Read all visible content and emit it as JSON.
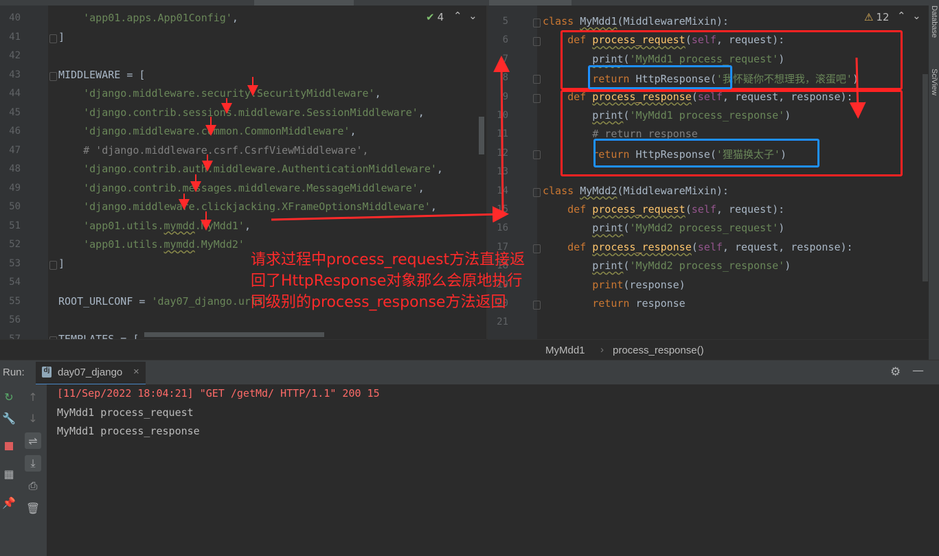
{
  "left_editor": {
    "lines": [
      {
        "n": "40",
        "html": "    <span class='str'>'app01.apps.App01Config'</span>,"
      },
      {
        "n": "41",
        "html": "]"
      },
      {
        "n": "42",
        "html": ""
      },
      {
        "n": "43",
        "html": "MIDDLEWARE = ["
      },
      {
        "n": "44",
        "html": "    <span class='str'>'django.middleware.security.SecurityMiddleware'</span>,"
      },
      {
        "n": "45",
        "html": "    <span class='str'>'django.contrib.sessions.middleware.SessionMiddleware'</span>,"
      },
      {
        "n": "46",
        "html": "    <span class='str'>'django.middleware.common.CommonMiddleware'</span>,"
      },
      {
        "n": "47",
        "html": "    <span class='cmt'># 'django.middleware.csrf.CsrfViewMiddleware',</span>"
      },
      {
        "n": "48",
        "html": "    <span class='str'>'django.contrib.auth.middleware.AuthenticationMiddleware'</span>,"
      },
      {
        "n": "49",
        "html": "    <span class='str'>'django.contrib.messages.middleware.MessageMiddleware'</span>,"
      },
      {
        "n": "50",
        "html": "    <span class='str'>'django.middleware.clickjacking.XFrameOptionsMiddleware'</span>,"
      },
      {
        "n": "51",
        "html": "    <span class='str'>'app01.utils.<span class=\"sq\">mymdd</span>.MyMdd1'</span>,"
      },
      {
        "n": "52",
        "html": "    <span class='str'>'app01.utils.<span class=\"sq\">mymdd</span>.MyMdd2'</span>"
      },
      {
        "n": "53",
        "html": "]"
      },
      {
        "n": "54",
        "html": ""
      },
      {
        "n": "55",
        "html": "ROOT_URLCONF = <span class='str'>'day07_django.urls'</span>"
      },
      {
        "n": "56",
        "html": ""
      },
      {
        "n": "57",
        "html": "TEMPLATES = ["
      }
    ],
    "inspection_count": "4"
  },
  "right_editor": {
    "lines": [
      {
        "n": "5",
        "html": "<span class='kw'>class</span> <span class='sq'>MyMdd1</span>(MiddlewareMixin):"
      },
      {
        "n": "6",
        "html": "    <span class='kw'>def</span> <span class='fn sq'>process_request</span>(<span class='self'>self</span>, request):"
      },
      {
        "n": "7",
        "html": "        <span class='sq'>print</span>(<span class='str'>'MyMdd1 process_request'</span>)"
      },
      {
        "n": "8",
        "html": "        <span class='kw'>return</span> HttpResponse(<span class='str'>'我怀疑你不想理我，滚蛋吧'</span>)"
      },
      {
        "n": "9",
        "html": "    <span class='kw'>def</span> <span class='fn sq'>process_response</span>(<span class='self'>self</span>, request, response):"
      },
      {
        "n": "10",
        "html": "        <span class='sq'>print</span>(<span class='str'>'MyMdd1 process_response'</span>)"
      },
      {
        "n": "11",
        "html": "        <span class='cmt'># return response</span>"
      },
      {
        "n": "12",
        "html": "        <span class='kw'>return</span> HttpResponse(<span class='str'>'狸猫换太子'</span>)"
      },
      {
        "n": "13",
        "html": ""
      },
      {
        "n": "14",
        "html": "<span class='kw'>class</span> <span class='sq'>MyMdd2</span>(MiddlewareMixin):"
      },
      {
        "n": "15",
        "html": "    <span class='kw'>def</span> <span class='fn sq'>process_request</span>(<span class='self'>self</span>, request):"
      },
      {
        "n": "16",
        "html": "        <span class='sq'>print</span>(<span class='str'>'MyMdd2 process_request'</span>)"
      },
      {
        "n": "17",
        "html": "    <span class='kw'>def</span> <span class='fn sq'>process_response</span>(<span class='self'>self</span>, request, response):"
      },
      {
        "n": "18",
        "html": "        <span class='sq'>print</span>(<span class='str'>'MyMdd2 process_response'</span>)"
      },
      {
        "n": "19",
        "html": "        <span class='kw'>print</span>(response)"
      },
      {
        "n": "20",
        "html": "        <span class='kw'>return</span> response"
      },
      {
        "n": "21",
        "html": ""
      }
    ],
    "warning_count": "12"
  },
  "side_labels": {
    "database": "Database",
    "sciview": "SciView"
  },
  "annotation": "请求过程中process_request方法直接返\n回了HttpResponse对象那么会原地执行\n同级别的process_response方法返回",
  "breadcrumb": {
    "class_name": "MyMdd1",
    "sep": "›",
    "method": "process_response()"
  },
  "run": {
    "label": "Run:",
    "tab": "day07_django",
    "output": [
      {
        "text": "[11/Sep/2022 18:04:21] \"GET /getMd/ HTTP/1.1\" 200 15",
        "color": "#ff6b68"
      },
      {
        "text": "MyMdd1 process_request",
        "color": "#bbbbbb"
      },
      {
        "text": "MyMdd1 process_response",
        "color": "#bbbbbb"
      }
    ]
  },
  "colors": {
    "annotation_red": "#ff2a2a",
    "highlight_blue": "#1e90ff",
    "keyword": "#cc7832",
    "string": "#6a8759"
  }
}
